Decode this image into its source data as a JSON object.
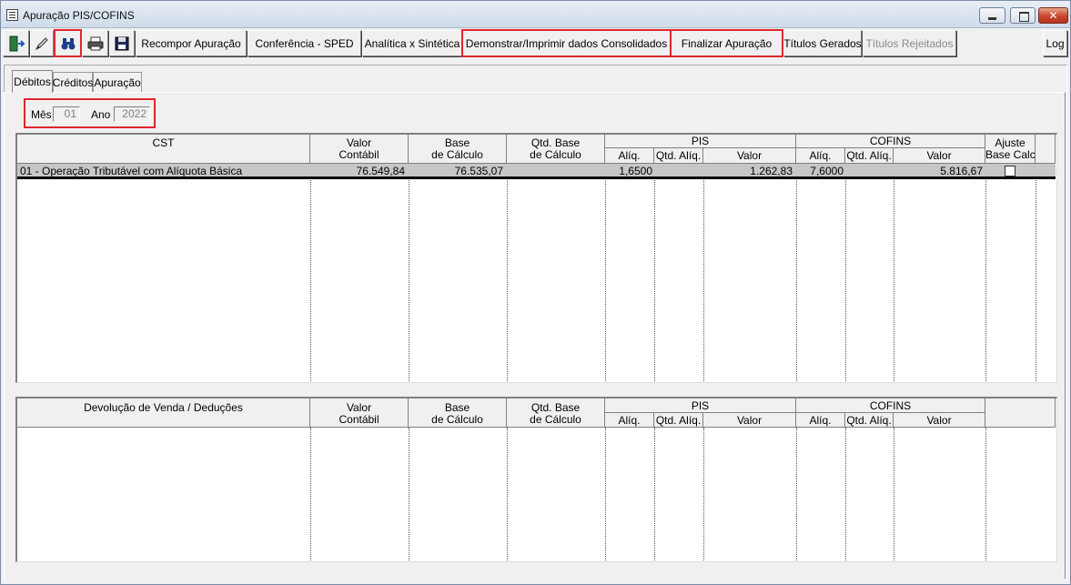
{
  "window": {
    "title": "Apuração PIS/COFINS"
  },
  "toolbar": {
    "buttons": [
      "Recompor Apuração",
      "Conferência - SPED",
      "Analítica x Sintética",
      "Demonstrar/Imprimir dados Consolidados",
      "Finalizar Apuração",
      "Títulos Gerados",
      "Títulos Rejeitados",
      "Log"
    ],
    "icons": [
      "exit-icon",
      "edit-icon",
      "search-binoculars-icon",
      "print-icon",
      "save-icon"
    ]
  },
  "tabs": [
    "Débitos",
    "Créditos",
    "Apuração"
  ],
  "period": {
    "month_label": "Mês",
    "month_value": "01",
    "year_label": "Ano",
    "year_value": "2022"
  },
  "debits_grid": {
    "headers": {
      "cst": "CST",
      "valor_contabil": "Valor\nContábil",
      "base_calculo": "Base\nde Cálculo",
      "qtd_base": "Qtd. Base\nde Cálculo",
      "pis": "PIS",
      "cofins": "COFINS",
      "aliq": "Alíq.",
      "qtd_aliq": "Qtd. Alíq.",
      "valor": "Valor",
      "ajuste": "Ajuste\nBase Calc."
    },
    "rows": [
      {
        "cst": "01 - Operação Tributável com Alíquota Básica",
        "valor_contabil": "76.549,84",
        "base_calculo": "76.535,07",
        "qtd_base": "",
        "pis_aliq": "1,6500",
        "pis_qtd_aliq": "",
        "pis_valor": "1.262,83",
        "cofins_aliq": "7,6000",
        "cofins_qtd_aliq": "",
        "cofins_valor": "5.816,67",
        "ajuste_checked": false
      }
    ]
  },
  "deductions_grid": {
    "headers": {
      "desc": "Devolução de Venda / Deduções",
      "valor_contabil": "Valor\nContábil",
      "base_calculo": "Base\nde Cálculo",
      "qtd_base": "Qtd. Base\nde Cálculo",
      "pis": "PIS",
      "cofins": "COFINS",
      "aliq": "Alíq.",
      "qtd_aliq": "Qtd. Alíq.",
      "valor": "Valor"
    }
  },
  "colors": {
    "highlight": "#e0262e",
    "selected_row": "#c7c7c7"
  }
}
